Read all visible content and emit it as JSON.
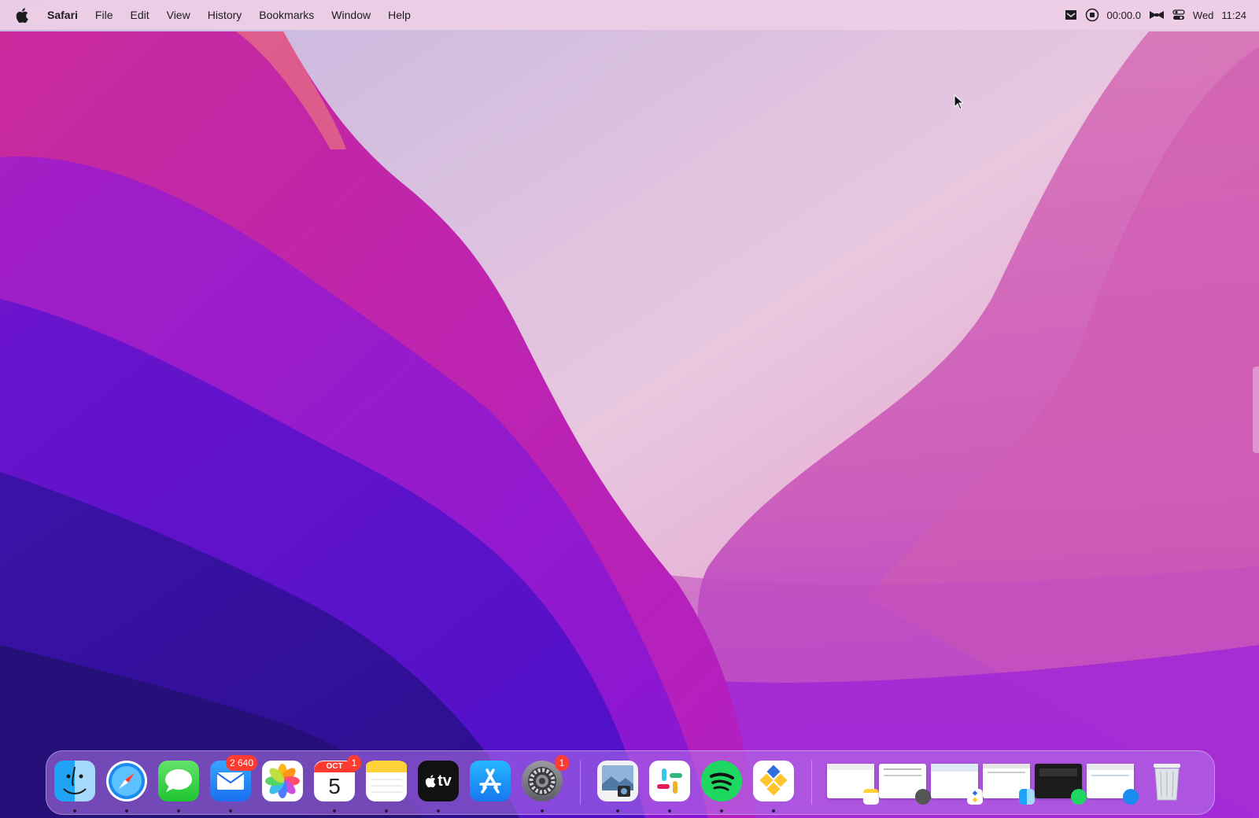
{
  "menubar": {
    "app_name": "Safari",
    "menus": [
      "File",
      "Edit",
      "View",
      "History",
      "Bookmarks",
      "Window",
      "Help"
    ],
    "status": {
      "recording_time": "00:00.0",
      "day": "Wed",
      "time": "11:24"
    }
  },
  "dock": {
    "apps": [
      {
        "name": "Finder",
        "running": true
      },
      {
        "name": "Safari",
        "running": true
      },
      {
        "name": "Messages",
        "running": true
      },
      {
        "name": "Mail",
        "running": true,
        "badge": "2 640"
      },
      {
        "name": "Photos",
        "running": false
      },
      {
        "name": "Calendar",
        "running": true,
        "badge": "1",
        "month": "OCT",
        "day": "5"
      },
      {
        "name": "Notes",
        "running": true
      },
      {
        "name": "TV",
        "running": true,
        "label": "tv"
      },
      {
        "name": "App Store",
        "running": false
      },
      {
        "name": "System Preferences",
        "running": true,
        "badge": "1"
      },
      {
        "name": "Preview",
        "running": true
      },
      {
        "name": "Slack",
        "running": true
      },
      {
        "name": "Spotify",
        "running": true
      },
      {
        "name": "Tool",
        "running": true
      }
    ],
    "minimized_windows": [
      {
        "app_icon": "notes-icon"
      },
      {
        "app_icon": "settings-icon"
      },
      {
        "app_icon": "tool-icon"
      },
      {
        "app_icon": "finder-icon"
      },
      {
        "app_icon": "spotify-icon"
      },
      {
        "app_icon": "safari-icon"
      }
    ]
  },
  "colors": {
    "menubar_bg": "#eecee6",
    "badge": "#ff3b30",
    "wallpaper_primary": "#b31fc4",
    "wallpaper_secondary": "#4a12c6",
    "wallpaper_light": "#c8c6e0"
  }
}
